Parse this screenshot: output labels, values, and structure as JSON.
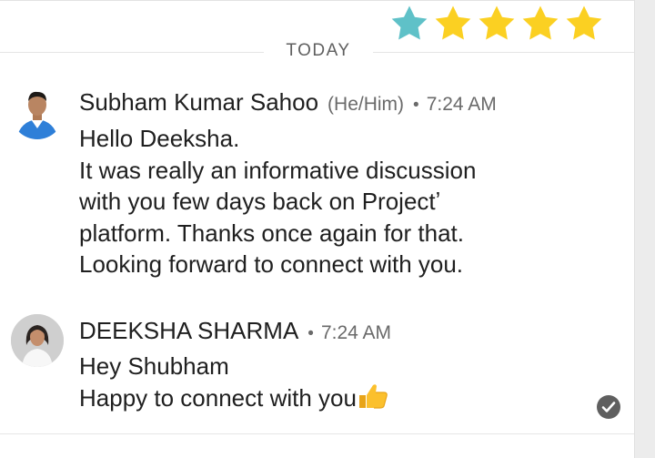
{
  "rating": {
    "stars_filled": 5,
    "stars_total": 5,
    "first_star_color": "#5fc1c8",
    "star_color": "#fbd022"
  },
  "divider": {
    "label": "TODAY"
  },
  "messages": [
    {
      "sender": "Subham Kumar Sahoo",
      "pronouns": "(He/Him)",
      "separator": "•",
      "time": "7:24 AM",
      "lines": [
        "Hello Deeksha.",
        "It was really an informative discussion",
        "with you few days back on Projectʼ",
        "platform. Thanks once again for that.",
        "Looking forward to connect with you."
      ]
    },
    {
      "sender": "DEEKSHA SHARMA",
      "separator": "•",
      "time": "7:24 AM",
      "lines": [
        "Hey Shubham",
        "Happy to connect with you"
      ],
      "emoji_icon": "thumbs-up-icon"
    }
  ],
  "status": {
    "icon": "seen-check-icon"
  }
}
